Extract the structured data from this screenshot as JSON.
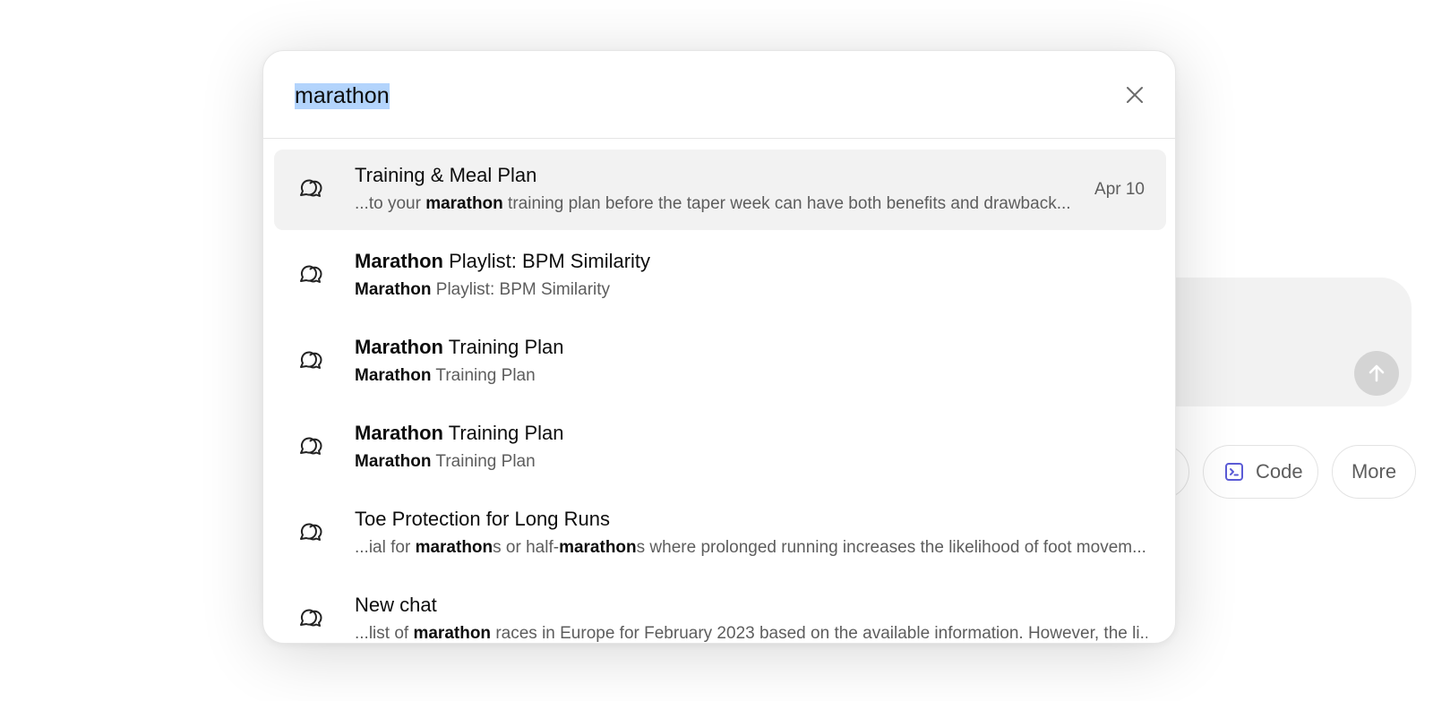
{
  "search": {
    "query": "marathon",
    "close_icon": "close-icon"
  },
  "results": [
    {
      "title": [
        {
          "t": "Training & Meal Plan",
          "b": false
        }
      ],
      "snippet": [
        {
          "t": "...to your ",
          "b": false
        },
        {
          "t": "marathon",
          "b": true
        },
        {
          "t": " training plan before the taper week can have both benefits and drawback...",
          "b": false
        }
      ],
      "date": "Apr 10",
      "active": true,
      "icon": "chat-bubbles-icon"
    },
    {
      "title": [
        {
          "t": "Marathon",
          "b": true
        },
        {
          "t": " Playlist: BPM Similarity",
          "b": false
        }
      ],
      "snippet": [
        {
          "t": "Marathon",
          "b": true
        },
        {
          "t": " Playlist: BPM Similarity",
          "b": false
        }
      ],
      "date": "",
      "active": false,
      "icon": "chat-bubbles-icon"
    },
    {
      "title": [
        {
          "t": "Marathon",
          "b": true
        },
        {
          "t": " Training Plan",
          "b": false
        }
      ],
      "snippet": [
        {
          "t": "Marathon",
          "b": true
        },
        {
          "t": " Training Plan",
          "b": false
        }
      ],
      "date": "",
      "active": false,
      "icon": "chat-bubbles-icon"
    },
    {
      "title": [
        {
          "t": "Marathon",
          "b": true
        },
        {
          "t": " Training Plan",
          "b": false
        }
      ],
      "snippet": [
        {
          "t": "Marathon",
          "b": true
        },
        {
          "t": " Training Plan",
          "b": false
        }
      ],
      "date": "",
      "active": false,
      "icon": "chat-bubbles-icon"
    },
    {
      "title": [
        {
          "t": "Toe Protection for Long Runs",
          "b": false
        }
      ],
      "snippet": [
        {
          "t": "...ial for ",
          "b": false
        },
        {
          "t": "marathon",
          "b": true
        },
        {
          "t": "s or half-",
          "b": false
        },
        {
          "t": "marathon",
          "b": true
        },
        {
          "t": "s where prolonged running increases the likelihood of foot movem...",
          "b": false
        }
      ],
      "date": "",
      "active": false,
      "icon": "chat-bubbles-icon"
    },
    {
      "title": [
        {
          "t": "New chat",
          "b": false
        }
      ],
      "snippet": [
        {
          "t": "...list of ",
          "b": false
        },
        {
          "t": "marathon",
          "b": true
        },
        {
          "t": " races in Europe for February 2023 based on the available information. However, the li...",
          "b": false
        }
      ],
      "date": "",
      "active": false,
      "icon": "chat-bubbles-icon"
    }
  ],
  "background": {
    "code_label": "Code",
    "more_label": "More",
    "code_icon": "code-terminal-icon",
    "send_icon": "arrow-up-icon"
  },
  "colors": {
    "selection": "#b3d4fc",
    "active_row": "#f2f2f2",
    "code_icon": "#5b5bd6"
  }
}
